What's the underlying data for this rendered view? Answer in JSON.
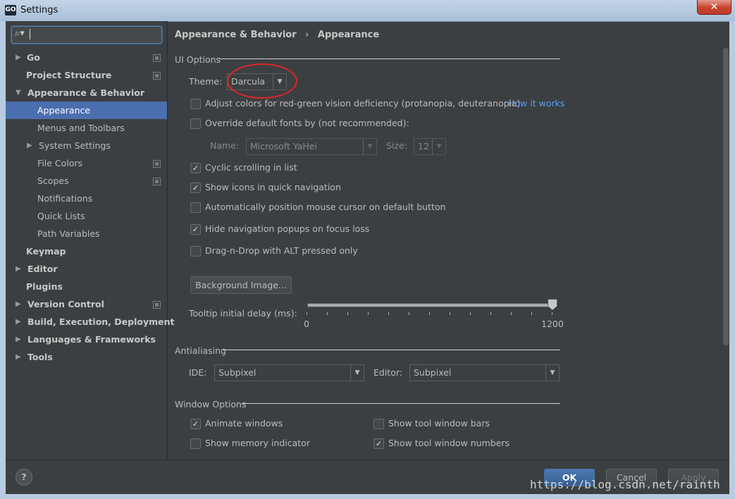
{
  "window": {
    "title": "Settings",
    "logo_text": "GO",
    "close_glyph": "✕"
  },
  "search": {
    "value": "",
    "icon": "search-icon"
  },
  "sidebar": {
    "items": [
      {
        "label": "Go",
        "expandable": true,
        "project": true
      },
      {
        "label": "Project Structure",
        "expandable": false,
        "project": true
      },
      {
        "label": "Appearance & Behavior",
        "expandable": true,
        "expanded": true
      },
      {
        "label": "Appearance",
        "selected": true
      },
      {
        "label": "Menus and Toolbars"
      },
      {
        "label": "System Settings",
        "expandable": true
      },
      {
        "label": "File Colors",
        "project": true
      },
      {
        "label": "Scopes",
        "project": true
      },
      {
        "label": "Notifications"
      },
      {
        "label": "Quick Lists"
      },
      {
        "label": "Path Variables"
      },
      {
        "label": "Keymap"
      },
      {
        "label": "Editor",
        "expandable": true
      },
      {
        "label": "Plugins"
      },
      {
        "label": "Version Control",
        "expandable": true,
        "project": true
      },
      {
        "label": "Build, Execution, Deployment",
        "expandable": true
      },
      {
        "label": "Languages & Frameworks",
        "expandable": true
      },
      {
        "label": "Tools",
        "expandable": true
      }
    ]
  },
  "breadcrumb": {
    "parent": "Appearance & Behavior",
    "separator": "›",
    "current": "Appearance"
  },
  "ui_options": {
    "title": "UI Options",
    "theme_label": "Theme:",
    "theme_value": "Darcula",
    "adjust_colors": {
      "label": "Adjust colors for red-green vision deficiency (protanopia, deuteranopia)",
      "checked": false
    },
    "how_it_works": "How it works",
    "override_fonts": {
      "label": "Override default fonts by (not recommended):",
      "checked": false
    },
    "name_label": "Name:",
    "name_value": "Microsoft YaHei",
    "size_label": "Size:",
    "size_value": "12",
    "cyclic_scrolling": {
      "label": "Cyclic scrolling in list",
      "checked": true
    },
    "show_icons": {
      "label": "Show icons in quick navigation",
      "checked": true
    },
    "auto_position": {
      "label": "Automatically position mouse cursor on default button",
      "checked": false
    },
    "hide_popups": {
      "label": "Hide navigation popups on focus loss",
      "checked": true
    },
    "drag_drop": {
      "label": "Drag-n-Drop with ALT pressed only",
      "checked": false
    },
    "background_image": "Background Image...",
    "tooltip_label": "Tooltip initial delay (ms):",
    "tooltip_min": "0",
    "tooltip_max": "1200",
    "tooltip_value": 1200
  },
  "antialiasing": {
    "title": "Antialiasing",
    "ide_label": "IDE:",
    "ide_value": "Subpixel",
    "editor_label": "Editor:",
    "editor_value": "Subpixel"
  },
  "window_options": {
    "title": "Window Options",
    "animate_windows": {
      "label": "Animate windows",
      "checked": true
    },
    "show_memory": {
      "label": "Show memory indicator",
      "checked": false
    },
    "show_tool_bars": {
      "label": "Show tool window bars",
      "checked": false
    },
    "show_tool_numbers": {
      "label": "Show tool window numbers",
      "checked": true
    }
  },
  "footer": {
    "help": "?",
    "ok": "OK",
    "cancel": "Cancel",
    "apply": "Apply"
  },
  "watermark": "https://blog.csdn.net/rainth",
  "colors": {
    "selection": "#4b6eaf",
    "link": "#589df6",
    "annotation": "#e0242c"
  }
}
